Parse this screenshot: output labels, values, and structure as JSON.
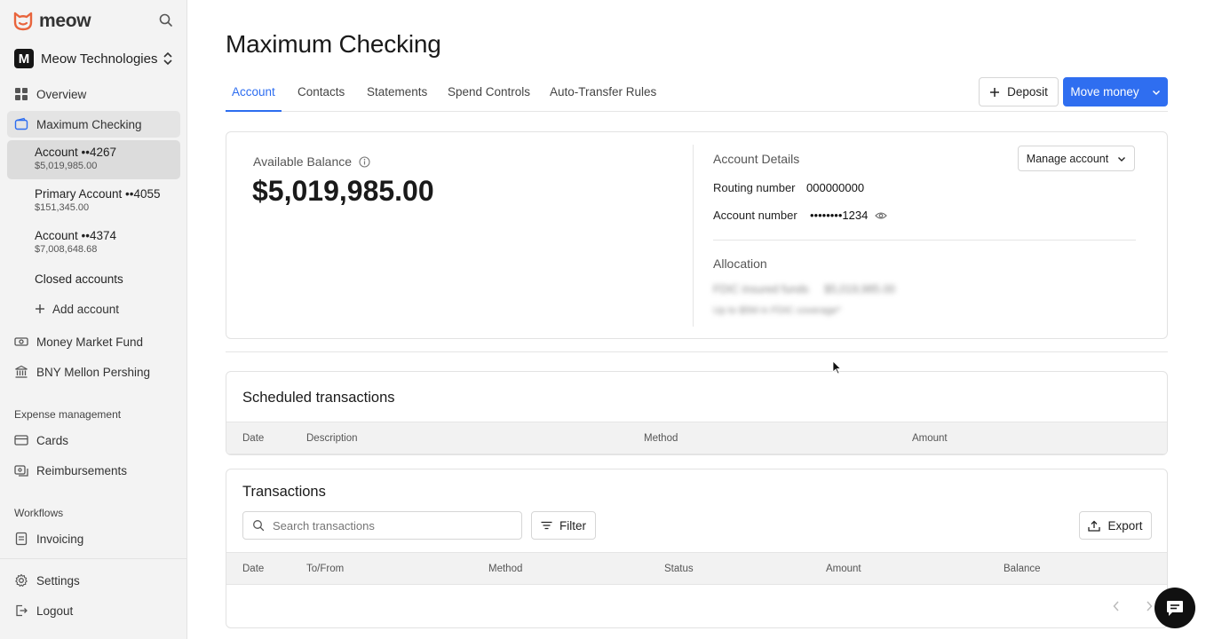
{
  "brand": {
    "name": "meow",
    "accent": "#e8643c"
  },
  "org": {
    "initial": "M",
    "name": "Meow Technologies"
  },
  "sidebar": {
    "overview": "Overview",
    "checking": "Maximum Checking",
    "accounts": [
      {
        "title": "Account ••4267",
        "amount": "$5,019,985.00"
      },
      {
        "title": "Primary Account ••4055",
        "amount": "$151,345.00"
      },
      {
        "title": "Account ••4374",
        "amount": "$7,008,648.68"
      }
    ],
    "closed": "Closed accounts",
    "add": "Add account",
    "mmf": "Money Market Fund",
    "bny": "BNY Mellon Pershing",
    "expense_label": "Expense management",
    "cards": "Cards",
    "reimbursements": "Reimbursements",
    "workflows_label": "Workflows",
    "invoicing": "Invoicing",
    "settings": "Settings",
    "logout": "Logout"
  },
  "main": {
    "title": "Maximum Checking",
    "tabs": [
      "Account",
      "Contacts",
      "Statements",
      "Spend Controls",
      "Auto-Transfer Rules"
    ],
    "deposit": "Deposit",
    "move_money": "Move money",
    "balance_label": "Available Balance",
    "balance": "$5,019,985.00",
    "details_label": "Account Details",
    "manage": "Manage account",
    "routing_label": "Routing number",
    "routing_value": "000000000",
    "account_label": "Account number",
    "account_value": "••••••••1234",
    "allocation_label": "Allocation",
    "alloc_line1a": "FDIC insured funds",
    "alloc_line1b": "$5,019,985.00",
    "alloc_line2": "Up to $5M in FDIC coverage*"
  },
  "scheduled": {
    "title": "Scheduled transactions",
    "columns": [
      "Date",
      "Description",
      "Method",
      "Amount"
    ]
  },
  "transactions": {
    "title": "Transactions",
    "search_placeholder": "Search transactions",
    "filter": "Filter",
    "export": "Export",
    "columns": [
      "Date",
      "To/From",
      "Method",
      "Status",
      "Amount",
      "Balance"
    ]
  }
}
